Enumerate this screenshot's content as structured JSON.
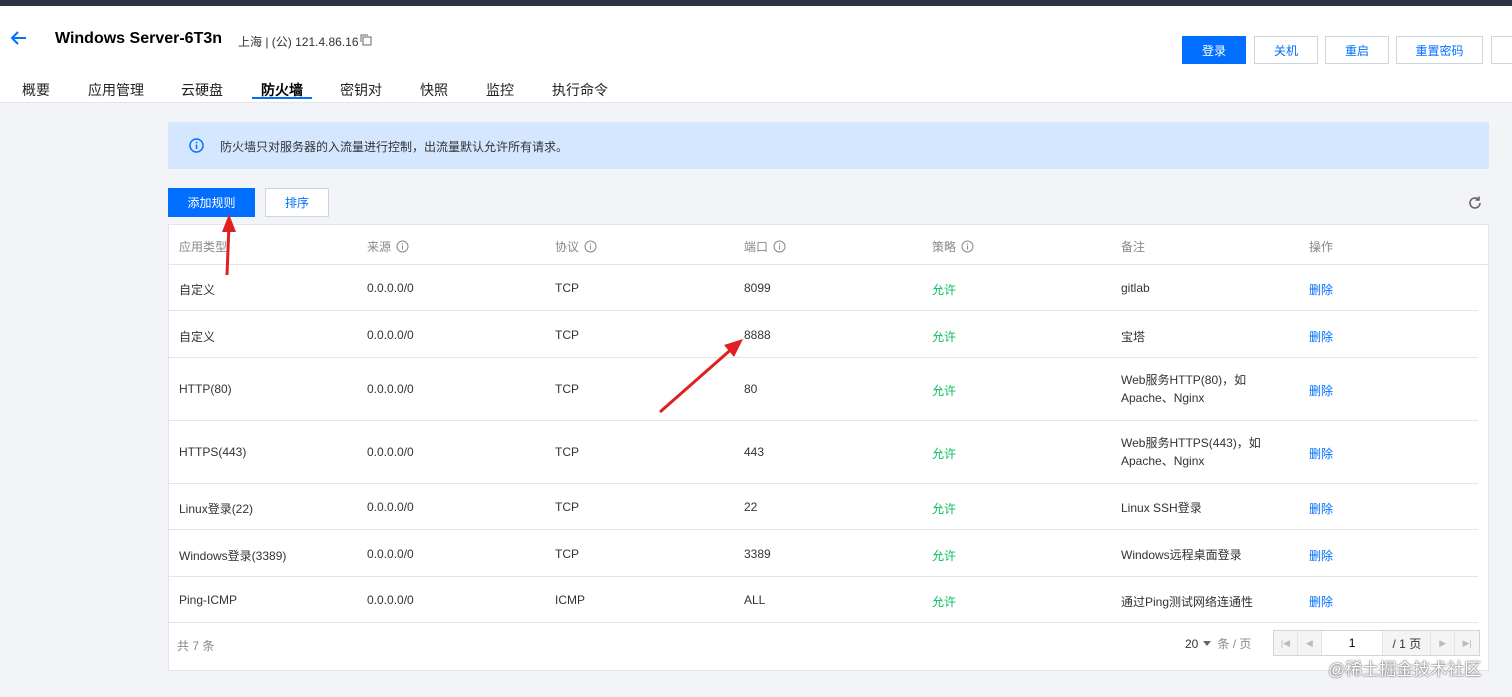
{
  "header": {
    "title": "Windows Server-6T3n",
    "region": "上海 | (公) 121.4.86.16",
    "buttons": {
      "login": "登录",
      "shutdown": "关机",
      "restart": "重启",
      "reset_password": "重置密码"
    }
  },
  "tabs": [
    "概要",
    "应用管理",
    "云硬盘",
    "防火墙",
    "密钥对",
    "快照",
    "监控",
    "执行命令"
  ],
  "active_tab": "防火墙",
  "notice": {
    "text": "防火墙只对服务器的入流量进行控制，出流量默认允许所有请求。"
  },
  "toolbar": {
    "add_rule": "添加规则",
    "sort": "排序"
  },
  "table": {
    "headers": [
      "应用类型",
      "来源",
      "协议",
      "端口",
      "策略",
      "备注",
      "操作"
    ],
    "rows": [
      {
        "type": "自定义",
        "source": "0.0.0.0/0",
        "protocol": "TCP",
        "port": "8099",
        "policy": "允许",
        "remark": "gitlab",
        "action": "删除"
      },
      {
        "type": "自定义",
        "source": "0.0.0.0/0",
        "protocol": "TCP",
        "port": "8888",
        "policy": "允许",
        "remark": "宝塔",
        "action": "删除"
      },
      {
        "type": "HTTP(80)",
        "source": "0.0.0.0/0",
        "protocol": "TCP",
        "port": "80",
        "policy": "允许",
        "remark": "Web服务HTTP(80)，如Apache、Nginx",
        "action": "删除"
      },
      {
        "type": "HTTPS(443)",
        "source": "0.0.0.0/0",
        "protocol": "TCP",
        "port": "443",
        "policy": "允许",
        "remark": "Web服务HTTPS(443)，如Apache、Nginx",
        "action": "删除"
      },
      {
        "type": "Linux登录(22)",
        "source": "0.0.0.0/0",
        "protocol": "TCP",
        "port": "22",
        "policy": "允许",
        "remark": "Linux SSH登录",
        "action": "删除"
      },
      {
        "type": "Windows登录(3389)",
        "source": "0.0.0.0/0",
        "protocol": "TCP",
        "port": "3389",
        "policy": "允许",
        "remark": "Windows远程桌面登录",
        "action": "删除"
      },
      {
        "type": "Ping-ICMP",
        "source": "0.0.0.0/0",
        "protocol": "ICMP",
        "port": "ALL",
        "policy": "允许",
        "remark": "通过Ping测试网络连通性",
        "action": "删除"
      }
    ]
  },
  "pagination": {
    "total": "共 7 条",
    "page_size": "20",
    "page_size_unit": "条 / 页",
    "current_page": "1",
    "total_pages": "/ 1 页"
  },
  "watermark": "@稀土掘金技术社区",
  "colors": {
    "primary": "#006eff",
    "allow": "#0abf5b",
    "annotation": "#e02020"
  }
}
